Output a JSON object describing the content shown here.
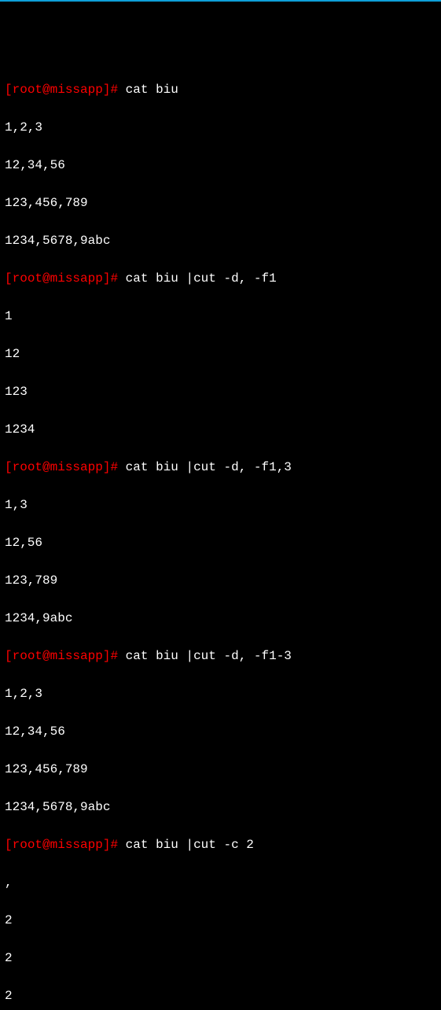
{
  "prompt": {
    "open": "[",
    "user": "root",
    "at": "@",
    "host": "missapp",
    "close": "]",
    "hash": "#"
  },
  "blocks": [
    {
      "command": " cat biu",
      "output": [
        "1,2,3",
        "12,34,56",
        "123,456,789",
        "1234,5678,9abc"
      ]
    },
    {
      "command": " cat biu |cut -d, -f1",
      "output": [
        "1",
        "12",
        "123",
        "1234"
      ]
    },
    {
      "command": " cat biu |cut -d, -f1,3",
      "output": [
        "1,3",
        "12,56",
        "123,789",
        "1234,9abc"
      ]
    },
    {
      "command": " cat biu |cut -d, -f1-3",
      "output": [
        "1,2,3",
        "12,34,56",
        "123,456,789",
        "1234,5678,9abc"
      ]
    },
    {
      "command": " cat biu |cut -c 2",
      "output": [
        ",",
        "2",
        "2",
        "2"
      ]
    }
  ]
}
